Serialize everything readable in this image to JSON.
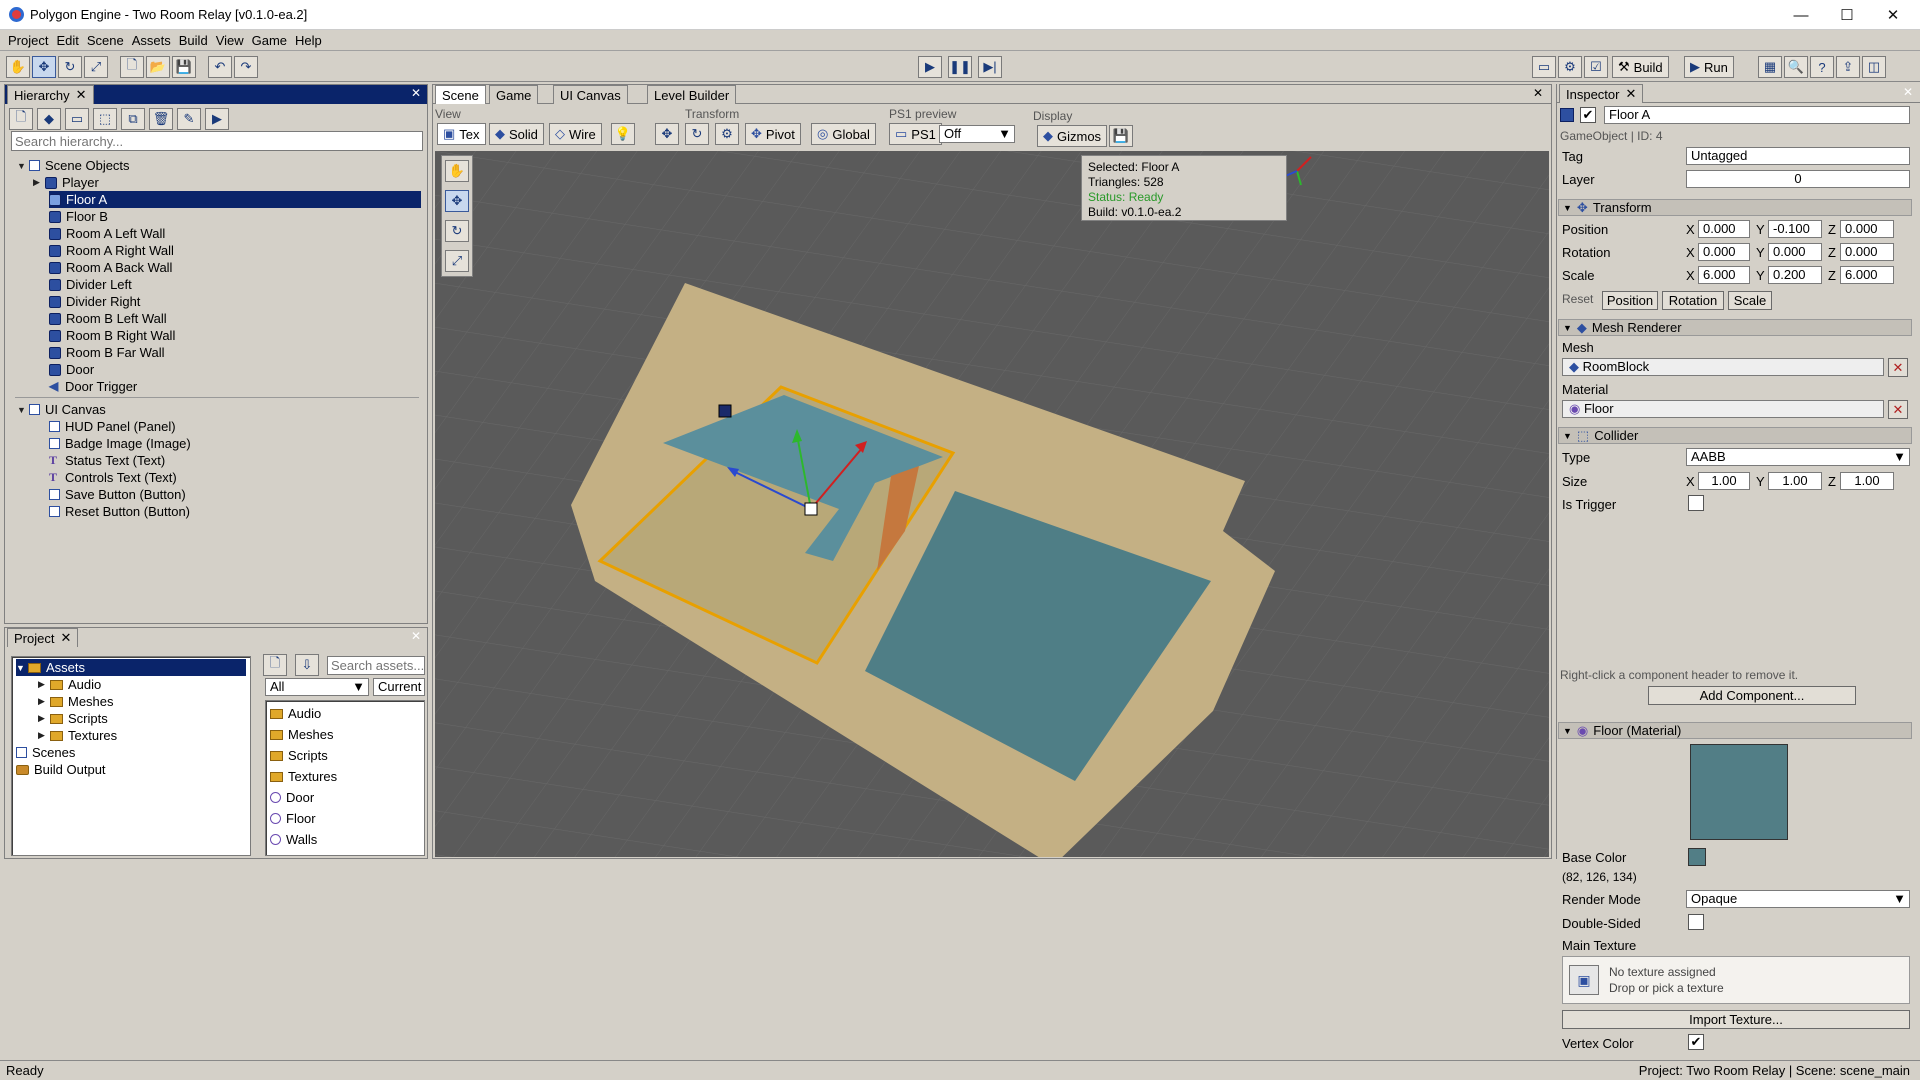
{
  "window": {
    "title": "Polygon Engine - Two Room Relay [v0.1.0-ea.2]",
    "minimize": "—",
    "maximize": "☐",
    "close": "✕"
  },
  "menu": [
    "Project",
    "Edit",
    "Scene",
    "Assets",
    "Build",
    "View",
    "Game",
    "Help"
  ],
  "toolbar": {
    "build_label": "Build",
    "run_label": "Run"
  },
  "hierarchy": {
    "tab": "Hierarchy",
    "search_placeholder": "Search hierarchy...",
    "scene_root": "Scene Objects",
    "items": [
      "Player",
      "Floor A",
      "Floor B",
      "Room A Left Wall",
      "Room A Right Wall",
      "Room A Back Wall",
      "Divider Left",
      "Divider Right",
      "Room B Left Wall",
      "Room B Right Wall",
      "Room B Far Wall",
      "Door",
      "Door Trigger"
    ],
    "ui_root": "UI Canvas",
    "ui_items": [
      "HUD Panel (Panel)",
      "Badge Image (Image)",
      "Status Text (Text)",
      "Controls Text (Text)",
      "Save Button (Button)",
      "Reset Button (Button)"
    ]
  },
  "project": {
    "tab": "Project",
    "tree_root": "Assets",
    "tree_children": [
      "Audio",
      "Meshes",
      "Scripts",
      "Textures"
    ],
    "tree_other": [
      "Scenes",
      "Build Output"
    ],
    "search_placeholder": "Search assets...",
    "filter_value": "All",
    "scope_value": "Current f",
    "files": [
      "Audio",
      "Meshes",
      "Scripts",
      "Textures",
      "Door",
      "Floor",
      "Walls"
    ]
  },
  "scene": {
    "tabs": [
      "Scene",
      "Game",
      "UI Canvas",
      "Level Builder"
    ],
    "view_label": "View",
    "view_buttons": [
      "Tex",
      "Solid",
      "Wire"
    ],
    "transform_label": "Transform",
    "pivot": "Pivot",
    "global": "Global",
    "ps1_label": "PS1 preview",
    "ps1_button": "PS1",
    "ps1_value": "Off",
    "display_label": "Display",
    "gizmos": "Gizmos",
    "info": {
      "selected": "Selected: Floor A",
      "triangles": "Triangles: 528",
      "status": "Status: Ready",
      "build": "Build: v0.1.0-ea.2"
    }
  },
  "inspector": {
    "tab": "Inspector",
    "name": "Floor A",
    "meta": "GameObject  |  ID: 4",
    "tag_label": "Tag",
    "tag": "Untagged",
    "layer_label": "Layer",
    "layer": "0",
    "transform_title": "Transform",
    "position_label": "Position",
    "rotation_label": "Rotation",
    "scale_label": "Scale",
    "position": [
      "0.000",
      "-0.100",
      "0.000"
    ],
    "rotation": [
      "0.000",
      "0.000",
      "0.000"
    ],
    "scale": [
      "6.000",
      "0.200",
      "6.000"
    ],
    "axis": [
      "X",
      "Y",
      "Z"
    ],
    "reset_label": "Reset",
    "reset_buttons": [
      "Position",
      "Rotation",
      "Scale"
    ],
    "mesh_renderer_title": "Mesh Renderer",
    "mesh_label": "Mesh",
    "mesh": "RoomBlock",
    "material_label": "Material",
    "material": "Floor",
    "collider_title": "Collider",
    "type_label": "Type",
    "type": "AABB",
    "size_label": "Size",
    "size": [
      "1.00",
      "1.00",
      "1.00"
    ],
    "trigger_label": "Is Trigger",
    "hint": "Right-click a component header to remove it.",
    "add_component": "Add Component...",
    "material_title": "Floor (Material)",
    "base_color_label": "Base Color",
    "base_color_rgb": "(82, 126, 134)",
    "base_color_hex": "#527e86",
    "render_mode_label": "Render Mode",
    "render_mode": "Opaque",
    "double_sided_label": "Double-Sided",
    "main_texture_label": "Main Texture",
    "no_texture": "No texture assigned",
    "drop_texture": "Drop or pick a texture",
    "import_texture": "Import Texture...",
    "vertex_color_label": "Vertex Color"
  },
  "status": {
    "left": "Ready",
    "right": "Project: Two Room Relay  |  Scene: scene_main"
  }
}
